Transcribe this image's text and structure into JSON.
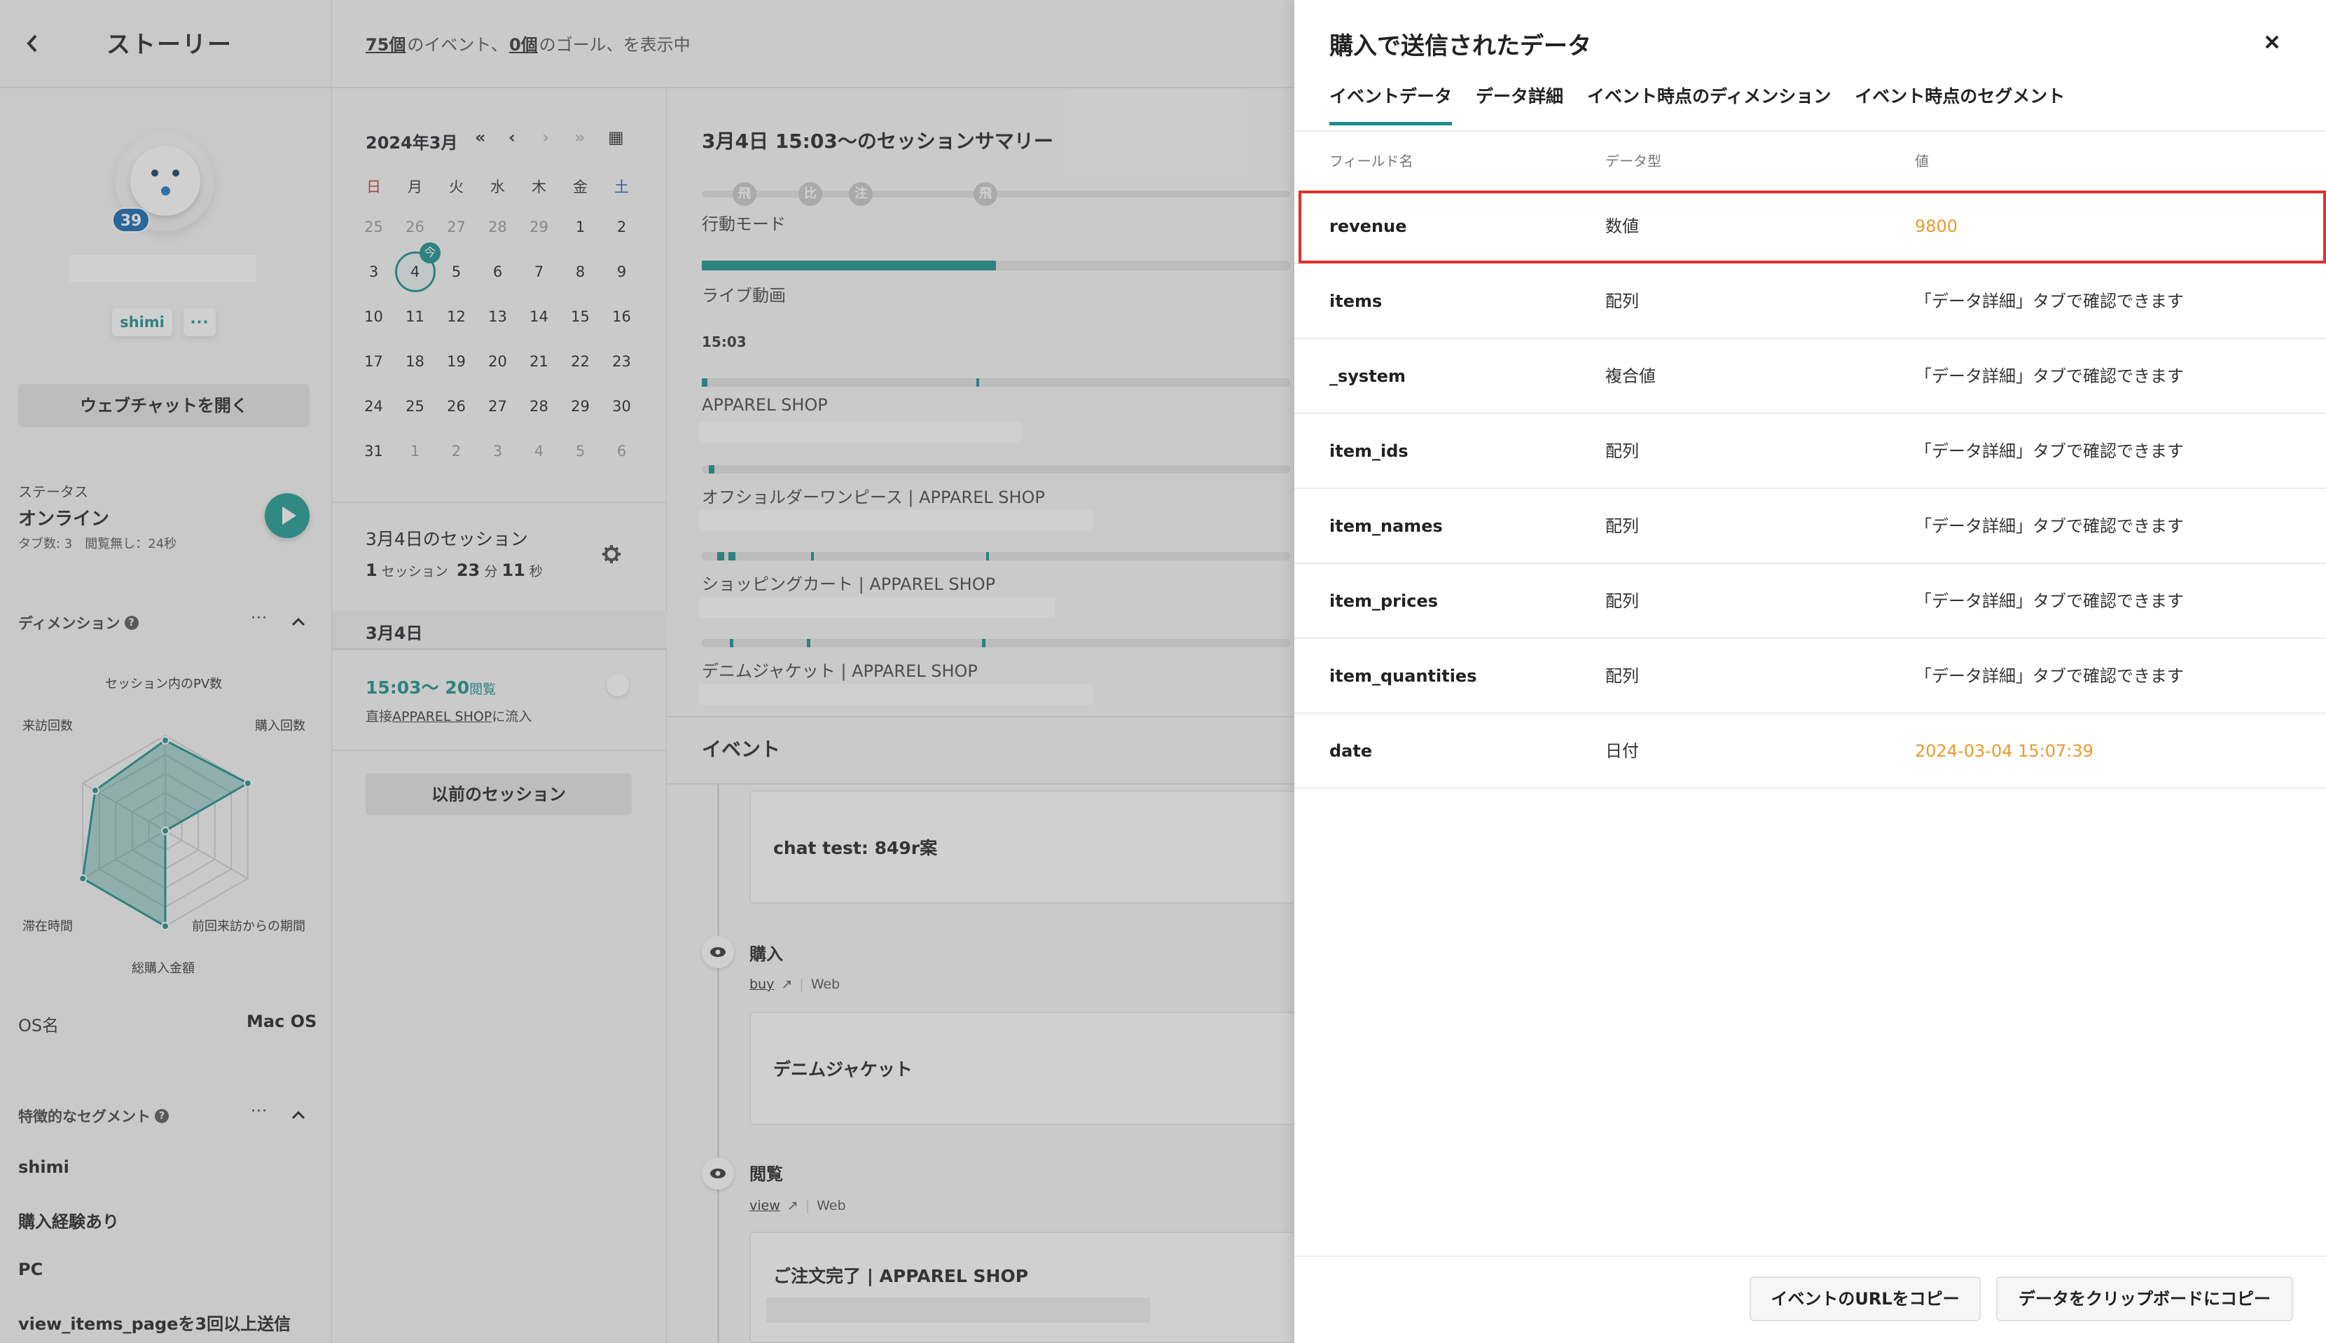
{
  "left": {
    "title": "ストーリー",
    "visit_badge": "39",
    "tags": [
      "shimi",
      "···"
    ],
    "webchat_button": "ウェブチャットを開く",
    "status_label": "ステータス",
    "status_value": "オンライン",
    "status_sub": "タブ数: 3　閲覧無し：24秒",
    "dimension_header": "ディメンション",
    "radar": {
      "labels": [
        "セッション内のPV数",
        "購入回数",
        "前回来訪からの期間",
        "総購入金額",
        "滞在時間",
        "来訪回数"
      ],
      "values": [
        0.95,
        1.0,
        0.0,
        1.0,
        1.0,
        0.85
      ]
    },
    "os_label": "OS名",
    "os_value": "Mac OS",
    "segment_header": "特徴的なセグメント",
    "segments": [
      "shimi",
      "購入経験あり",
      "PC",
      "view_items_pageを3回以上送信"
    ]
  },
  "topbar": {
    "events_count": "75個",
    "events_text": "のイベント、",
    "goals_count": "0個",
    "goals_text": "のゴール、を表示中"
  },
  "calendar": {
    "month": "2024年3月",
    "nav": [
      "«",
      "‹",
      "›",
      "»",
      "▦"
    ],
    "weekdays": [
      "日",
      "月",
      "火",
      "水",
      "木",
      "金",
      "土"
    ],
    "weeks": [
      [
        "25",
        "26",
        "27",
        "28",
        "29",
        "1",
        "2"
      ],
      [
        "3",
        "4",
        "5",
        "6",
        "7",
        "8",
        "9"
      ],
      [
        "10",
        "11",
        "12",
        "13",
        "14",
        "15",
        "16"
      ],
      [
        "17",
        "18",
        "19",
        "20",
        "21",
        "22",
        "23"
      ],
      [
        "24",
        "25",
        "26",
        "27",
        "28",
        "29",
        "30"
      ],
      [
        "31",
        "1",
        "2",
        "3",
        "4",
        "5",
        "6"
      ]
    ],
    "today_badge": "今",
    "sessions_title": "3月4日のセッション",
    "sessions_count": "1",
    "sessions_unit": "セッション",
    "duration_min": "23",
    "duration_min_unit": "分",
    "duration_sec": "11",
    "duration_sec_unit": "秒",
    "day_header": "3月4日",
    "session_time": "15:03〜",
    "session_pv": "20",
    "session_pv_unit": "閲覧",
    "referral_prefix": "直接",
    "referral_link": "APPAREL SHOP",
    "referral_suffix": "に流入",
    "prev_button": "以前のセッション"
  },
  "summary": {
    "title": "3月4日 15:03〜のセッションサマリー",
    "mode_icons": [
      "飛",
      "比",
      "注",
      "飛"
    ],
    "mode_label": "行動モード",
    "live_label": "ライブ動画",
    "time_label": "15:03",
    "pages": [
      "APPAREL SHOP",
      "オフショルダーワンピース | APPAREL SHOP",
      "ショッピングカート | APPAREL SHOP",
      "デニムジャケット | APPAREL SHOP"
    ],
    "events_header": "イベント",
    "events": [
      {
        "card": "chat test: 849r案"
      },
      {
        "name": "購入",
        "link": "buy",
        "channel": "Web",
        "card": "デニムジャケット"
      },
      {
        "name": "閲覧",
        "link": "view",
        "channel": "Web",
        "card": "ご注文完了 | APPAREL SHOP"
      }
    ]
  },
  "panel": {
    "title": "購入で送信されたデータ",
    "tabs": [
      "イベントデータ",
      "データ詳細",
      "イベント時点のディメンション",
      "イベント時点のセグメント"
    ],
    "columns": [
      "フィールド名",
      "データ型",
      "値"
    ],
    "rows": [
      {
        "field": "revenue",
        "type": "数値",
        "value": "9800",
        "accent": true
      },
      {
        "field": "items",
        "type": "配列",
        "value": "「データ詳細」タブで確認できます",
        "accent": false
      },
      {
        "field": "_system",
        "type": "複合値",
        "value": "「データ詳細」タブで確認できます",
        "accent": false
      },
      {
        "field": "item_ids",
        "type": "配列",
        "value": "「データ詳細」タブで確認できます",
        "accent": false
      },
      {
        "field": "item_names",
        "type": "配列",
        "value": "「データ詳細」タブで確認できます",
        "accent": false
      },
      {
        "field": "item_prices",
        "type": "配列",
        "value": "「データ詳細」タブで確認できます",
        "accent": false
      },
      {
        "field": "item_quantities",
        "type": "配列",
        "value": "「データ詳細」タブで確認できます",
        "accent": false
      },
      {
        "field": "date",
        "type": "日付",
        "value": "2024-03-04 15:07:39",
        "accent": true
      }
    ],
    "copy_url_button": "イベントのURLをコピー",
    "copy_data_button": "データをクリップボードにコピー"
  }
}
